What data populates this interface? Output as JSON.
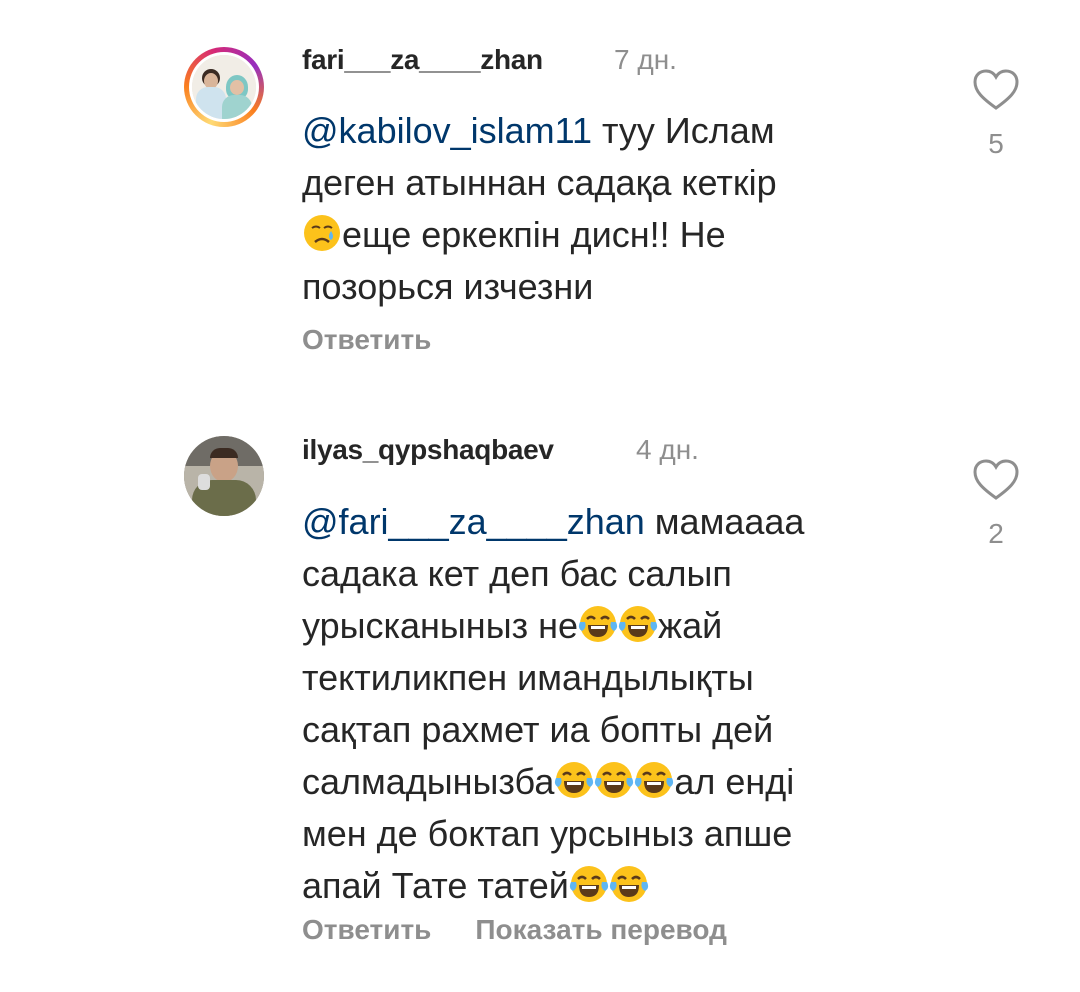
{
  "comments": [
    {
      "username": "fari___za____zhan",
      "time": "7 дн.",
      "mention": "@kabilov_islam11",
      "text_lines": [
        " туу Ислам",
        "деген атыннан садақа кеткір",
        "еще еркекпін дисн!! Не",
        "позорься изчезни"
      ],
      "emoji": [
        "crying-face"
      ],
      "likes": "5",
      "reply_label": "Ответить"
    },
    {
      "username": "ilyas_qypshaqbaev",
      "time": "4 дн.",
      "mention": "@fari___za____zhan",
      "text_lines": [
        " мамаааа",
        "садака кет деп бас салып",
        "урысканыныз не",
        "жай",
        "тектиликпен имандылықты",
        "сақтап рахмет иа бопты дей",
        "салмадынызба",
        "ал енді",
        "мен де боктап урсыныз апше",
        "апай Тате татей"
      ],
      "emoji": [
        "tears-of-joy-face"
      ],
      "likes": "2",
      "reply_label": "Ответить",
      "translate_label": "Показать перевод"
    }
  ],
  "colors": {
    "text": "#262626",
    "secondary": "#8e8e8e",
    "mention": "#00376b",
    "story_ring": "#d62976"
  }
}
